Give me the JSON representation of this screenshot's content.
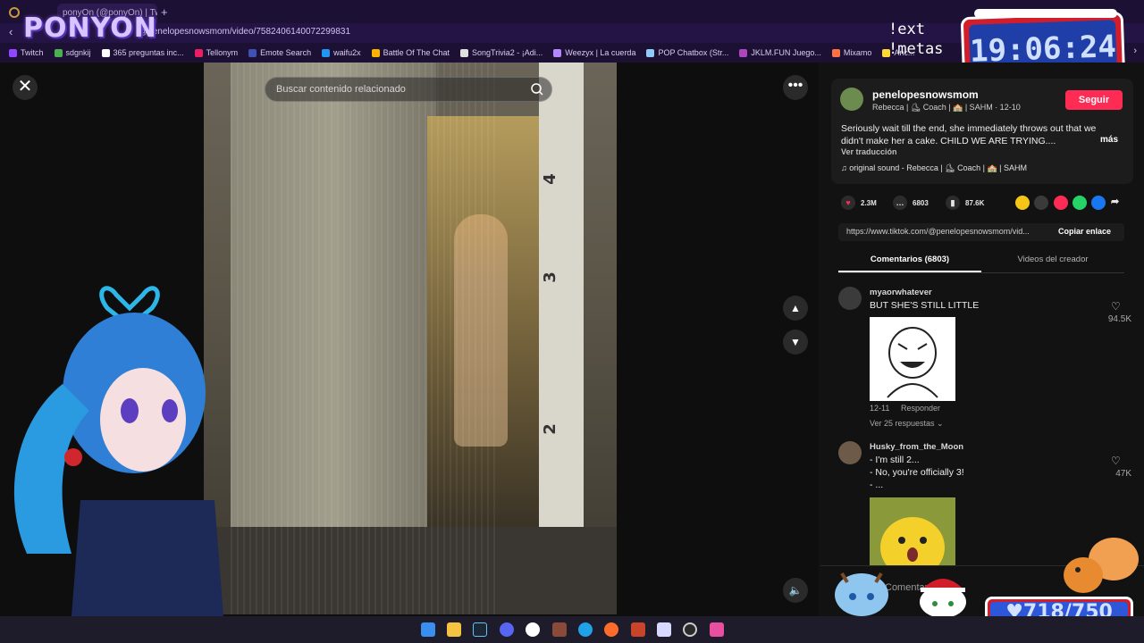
{
  "browser": {
    "tab_title": "ponyOn (@ponyOn) | Tw",
    "url": "@penelopesnowsmom/video/7582406140072299831",
    "bookmarks": [
      {
        "label": "Twitch",
        "color": "#9146ff"
      },
      {
        "label": "sdgnkij",
        "color": "#4caf50"
      },
      {
        "label": "365 preguntas inc...",
        "color": "#ffffff"
      },
      {
        "label": "Tellonym",
        "color": "#e91e63"
      },
      {
        "label": "Emote Search",
        "color": "#3f51b5"
      },
      {
        "label": "waifu2x",
        "color": "#2196f3"
      },
      {
        "label": "Battle Of The Chat",
        "color": "#ffb300"
      },
      {
        "label": "SongTrivia2 - ¡Adi...",
        "color": "#e0e0e0"
      },
      {
        "label": "Weezyx | La cuerda",
        "color": "#b388ff"
      },
      {
        "label": "POP Chatbox (Str...",
        "color": "#90caf9"
      },
      {
        "label": "JKLM.FUN Juego...",
        "color": "#ab47bc"
      },
      {
        "label": "Mixamo",
        "color": "#ff7043"
      },
      {
        "label": "Anc...",
        "color": "#fdd835"
      }
    ]
  },
  "overlay": {
    "logo": "PONYON",
    "chat_commands": "!ext\n!metas",
    "clock": "19:06:24",
    "counter": "718/750"
  },
  "video": {
    "search_placeholder": "Buscar contenido relacionado",
    "ruler_numbers": [
      "4",
      "3",
      "2"
    ]
  },
  "author": {
    "username": "penelopesnowsmom",
    "bio": "Rebecca | ⛸ Coach | 🏫 | SAHM · 12-10",
    "follow_label": "Seguir",
    "description": "Seriously wait till the end, she immediately throws out that we didn't make her a cake. CHILD WE ARE TRYING....",
    "more_label": "más",
    "translate_label": "Ver traducción",
    "sound": "original sound - Rebecca | ⛸ Coach | 🏫 | SAHM"
  },
  "actions": {
    "likes": "2.3M",
    "comments": "6803",
    "saves": "87.6K",
    "link": "https://www.tiktok.com/@penelopesnowsmom/vid...",
    "copy_label": "Copiar enlace"
  },
  "tabs": {
    "comments": "Comentarios (6803)",
    "videos": "Videos del creador"
  },
  "comments": [
    {
      "user": "myaorwhatever",
      "text": "BUT SHE'S STILL LITTLE",
      "likes": "94.5K",
      "date": "12-11",
      "reply": "Responder",
      "replies": "Ver 25 respuestas ⌄"
    },
    {
      "user": "Husky_from_the_Moon",
      "text": "- I'm still 2...\n- No, you're officially 3!\n- ...",
      "likes": "47K"
    }
  ],
  "comment_input_placeholder": "Comentar..."
}
